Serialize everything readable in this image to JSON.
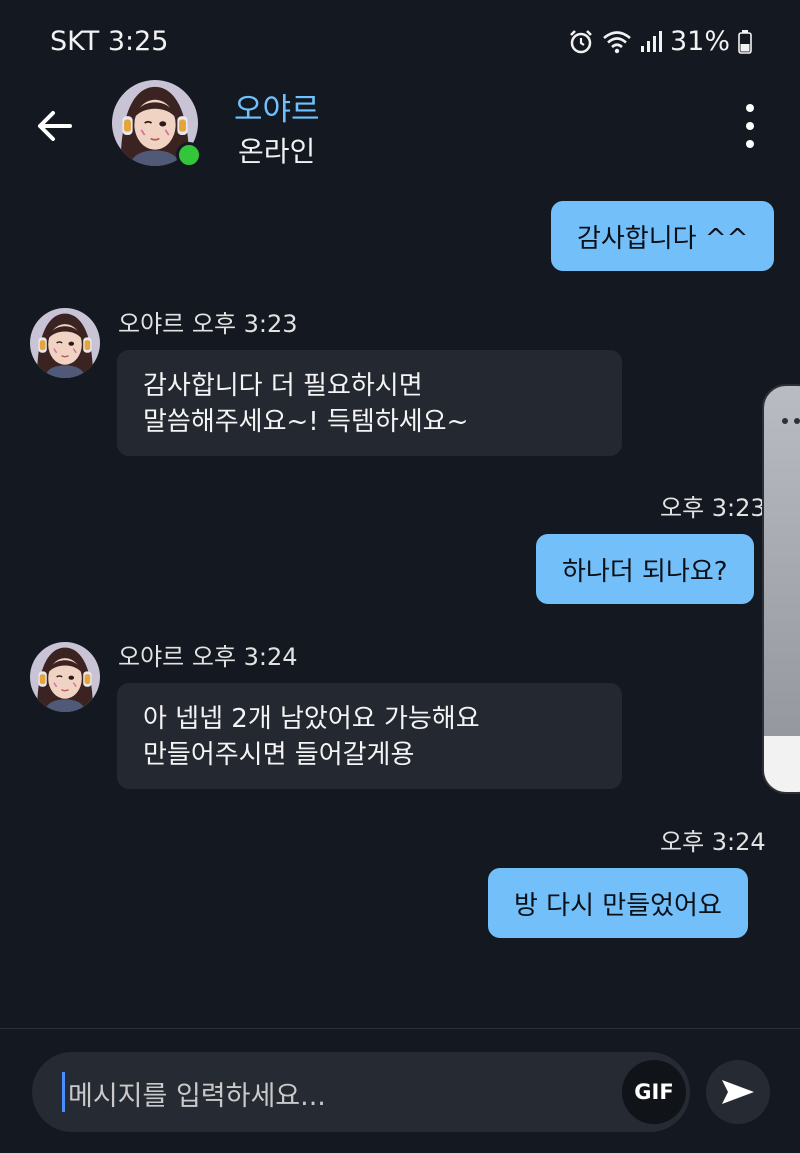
{
  "status_bar": {
    "carrier_time": "SKT 3:25",
    "battery": "31%",
    "icons": [
      "alarm-icon",
      "wifi-icon",
      "signal-icon",
      "battery-icon"
    ]
  },
  "header": {
    "name": "오야르",
    "status": "온라인",
    "name_color": "#6ec2ff",
    "online_color": "#33c63a"
  },
  "messages": [
    {
      "type": "out",
      "text": "감사합니다 ^^"
    },
    {
      "type": "in",
      "meta": "오야르 오후 3:23",
      "lines": [
        "감사합니다 더 필요하시면",
        "말씀해주세요~! 득템하세요~"
      ]
    },
    {
      "type": "out",
      "meta": "오후 3:23",
      "text": "하나더 되나요?"
    },
    {
      "type": "in",
      "meta": "오야르 오후 3:24",
      "lines": [
        "아 넵넵 2개 남았어요 가능해요",
        "만들어주시면 들어갈게용"
      ]
    },
    {
      "type": "out",
      "meta": "오후 3:24",
      "text": "방 다시 만들었어요"
    }
  ],
  "composer": {
    "placeholder": "메시지를 입력하세요...",
    "gif_label": "GIF"
  },
  "colors": {
    "background": "#141820",
    "outgoing_bubble": "#73bffa",
    "incoming_bubble": "#242830"
  }
}
